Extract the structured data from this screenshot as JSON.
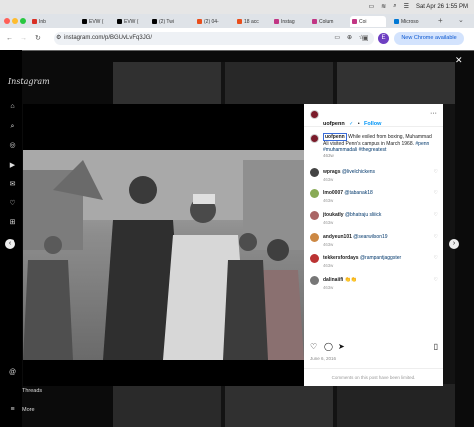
{
  "macos": {
    "clock": "Sat Apr 26 1:55 PM"
  },
  "browser": {
    "tabs": [
      {
        "label": "Inb",
        "color": "#d93025"
      },
      {
        "label": "EVW (",
        "color": "#000000"
      },
      {
        "label": "EVW (",
        "color": "#000000"
      },
      {
        "label": "(2) Twi",
        "color": "#000000"
      },
      {
        "label": "(2) 04-",
        "color": "#e94e1b"
      },
      {
        "label": "18 acc",
        "color": "#e94e1b"
      },
      {
        "label": "Instag",
        "color": "#c13584"
      },
      {
        "label": "Colum",
        "color": "#c13584"
      },
      {
        "label": "Coi",
        "color": "#c13584"
      },
      {
        "label": "Microso",
        "color": "#0078d4"
      }
    ],
    "url": "instagram.com/p/BGUvLvFq3JG/",
    "profile_letter": "E",
    "new_chrome_label": "New Chrome available"
  },
  "instagram": {
    "logo": "Instagram",
    "sidebar_bottom": {
      "threads": "Threads",
      "more": "More"
    }
  },
  "post": {
    "username": "uofpenn",
    "verified_mark": "✓",
    "follow_label": "Follow",
    "dot": "•",
    "more_icon_glyph": "···",
    "caption_user": "uofpenn",
    "caption_text": "While exiled from boxing, Muhammad Ali visited Penn's campus in March 1968.",
    "caption_tags": "#penn #muhammadali #thegreatest",
    "caption_time": "463w",
    "comments": [
      {
        "user": "wprags",
        "text": "@livelchickens",
        "time": "463w",
        "color": "#444"
      },
      {
        "user": "lmo0007",
        "text": "@tabanak18",
        "time": "463w",
        "color": "#8a5"
      },
      {
        "user": "jtoukatly",
        "text": "@bhatraju sliiick",
        "time": "463w",
        "color": "#a66"
      },
      {
        "user": "andyeun101",
        "text": "@searwilson19",
        "time": "463w",
        "color": "#c84"
      },
      {
        "user": "tekkersfordays",
        "text": "@rampantjaggster",
        "time": "463w",
        "color": "#b33"
      },
      {
        "user": "dalinaiifi",
        "text": "👏👏",
        "time": "463w",
        "color": "#777"
      }
    ],
    "date": "June 6, 2016",
    "comments_limited": "Comments on this post have been limited."
  }
}
